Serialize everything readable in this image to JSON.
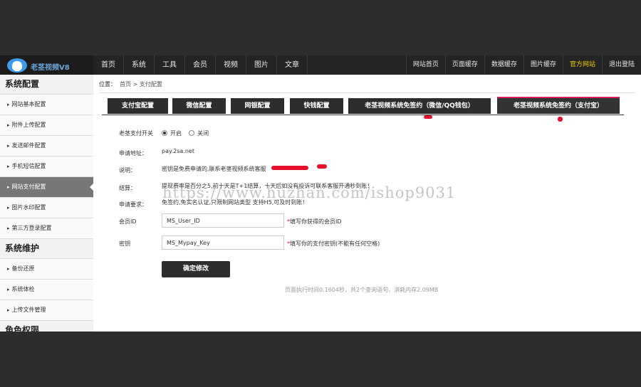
{
  "nav": {
    "logo_text": "老茎视频V8",
    "left_items": [
      "首页",
      "系统",
      "工具",
      "会员",
      "视频",
      "图片",
      "文章"
    ],
    "right_items": [
      "网站首页",
      "页面缓存",
      "数据缓存",
      "图片缓存",
      "官方网站",
      "退出登陆"
    ],
    "highlight_color": "#f5d000"
  },
  "sidebar": {
    "sections": [
      {
        "title": "系统配置",
        "items": [
          "网站基本配置",
          "附件上传配置",
          "发送邮件配置",
          "手机短信配置",
          "网站支付配置",
          "图片水印配置",
          "第三方登录配置"
        ]
      },
      {
        "title": "系统维护",
        "items": [
          "备份还原",
          "系统体检",
          "上传文件管理"
        ]
      },
      {
        "title": "角色权限",
        "items": []
      }
    ],
    "active_item": "网站支付配置"
  },
  "breadcrumb": {
    "label": "位置：",
    "home": "首页",
    "sep": ">",
    "current": "支付配置"
  },
  "tabs": [
    "支付宝配置",
    "微信配置",
    "网银配置",
    "快钱配置",
    "老茎视频系统免签约（微信/QQ钱包）",
    "老茎视频系统免签约（支付宝）"
  ],
  "active_tab": 5,
  "form": {
    "switch": {
      "label": "老茎支付开关",
      "on": "开启",
      "off": "关闭",
      "selected": "on"
    },
    "apply_url": {
      "label": "申请地址：",
      "value": "pay.2sa.net"
    },
    "desc": {
      "label": "说明：",
      "value": "密钥是免费申请的,联系老茎视频系统客服"
    },
    "settle": {
      "label": "结算：",
      "value": "提现费率是百分之5,前十天是T+1结算，十天后如没有投诉可联系客服开通秒到账！"
    },
    "require": {
      "label": "申请要求：",
      "value": "免签约,免实名认证,只限制网站类型 支持H5,可及时到账！"
    },
    "member_id": {
      "label": "会员ID",
      "value": "MS_User_ID",
      "hint": "填写你获得的会员ID"
    },
    "key": {
      "label": "密钥",
      "value": "MS_Mypay_Key",
      "hint": "填写你的支付密钥(不能有任何空格)"
    },
    "submit": "确定修改"
  },
  "footer_note": "页面执行时间0.1604秒，共2个查询语句，消耗内存2.09MB",
  "watermark": "https://www.huzhan.com/ishop9031",
  "accent_color": "#d81e5b"
}
